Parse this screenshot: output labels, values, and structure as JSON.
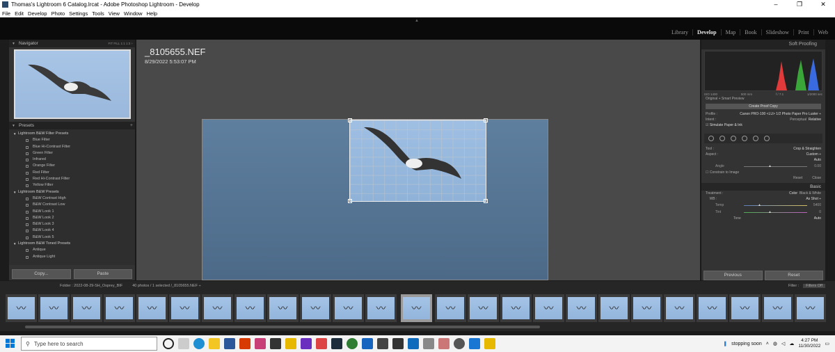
{
  "window": {
    "title": "Thomas's Lightroom 6 Catalog.lrcat - Adobe Photoshop Lightroom - Develop",
    "controls": [
      "–",
      "❐",
      "✕"
    ]
  },
  "menu": [
    "File",
    "Edit",
    "Develop",
    "Photo",
    "Settings",
    "Tools",
    "View",
    "Window",
    "Help"
  ],
  "modules": [
    "Library",
    "Develop",
    "Map",
    "Book",
    "Slideshow",
    "Print",
    "Web"
  ],
  "active_module": "Develop",
  "navigator": {
    "title": "Navigator",
    "options": "FIT  FILL  1:1  1:3 ÷"
  },
  "presets": {
    "title": "Presets",
    "add": "+",
    "folders": [
      {
        "name": "Lightroom B&W Filter Presets",
        "items": [
          "Blue Filter",
          "Blue Hi-Contrast Filter",
          "Green Filter",
          "Infrared",
          "Orange Filter",
          "Red Filter",
          "Red Hi-Contrast Filter",
          "Yellow Filter"
        ]
      },
      {
        "name": "Lightroom B&W Presets",
        "items": [
          "B&W Contrast High",
          "B&W Contrast Low",
          "B&W Look 1",
          "B&W Look 2",
          "B&W Look 3",
          "B&W Look 4",
          "B&W Look 5"
        ]
      },
      {
        "name": "Lightroom B&W Toned Presets",
        "items": [
          "Antique",
          "Antique Light"
        ]
      }
    ]
  },
  "copy_label": "Copy...",
  "paste_label": "Paste",
  "photo": {
    "filename": "_8105655.NEF",
    "datetime": "8/29/2022 5:53:07 PM"
  },
  "soft_proofing": {
    "title": "Soft Proofing",
    "hist_info": [
      "ISO 1400",
      "500 mm",
      "f / 7.1",
      "1/2000 sec"
    ],
    "original_label": "Original + Smart Preview",
    "create_proof": "Create Proof Copy",
    "profile_label": "Profile :",
    "profile_value": "Canon PRO-100 <LU> 1/2 Photo Paper Pro Luster ÷",
    "intent_label": "Intent :",
    "intent_a": "Perceptual",
    "intent_b": "Relative",
    "simulate": "Simulate Paper & Ink"
  },
  "crop": {
    "tool_label": "Tool :",
    "tool_value": "Crop & Straighten",
    "aspect_label": "Aspect :",
    "aspect_value": "Custom ÷",
    "auto": "Auto",
    "angle_label": "Angle",
    "angle_value": "0.00",
    "constrain": "Constrain to Image",
    "reset": "Reset",
    "close": "Close"
  },
  "basic": {
    "title": "Basic",
    "treatment_label": "Treatment :",
    "color": "Color",
    "bw": "Black & White",
    "wb_label": "WB :",
    "wb_value": "As Shot ÷",
    "temp_label": "Temp",
    "temp_value": "5400",
    "tint_label": "Tint",
    "tint_value": "0",
    "tone_label": "Tone",
    "tone_auto": "Auto"
  },
  "prev_label": "Previous",
  "reset_label": "Reset",
  "filmbar": {
    "folder": "Folder : 2022-08-29-SH_Osprey_BIF",
    "count": "40 photos / 1 selected /_8105655.NEF ÷",
    "filter_label": "Filter :",
    "filter_value": "Filters Off"
  },
  "taskbar": {
    "search_placeholder": "Type here to search",
    "weather": "stopping soon",
    "time": "4:27 PM",
    "date": "11/30/2022"
  },
  "colors": {
    "panel": "#333333",
    "accent_green": "#3aa63a",
    "hist_red": "#e03a3a",
    "hist_blue": "#3a6ae0"
  }
}
